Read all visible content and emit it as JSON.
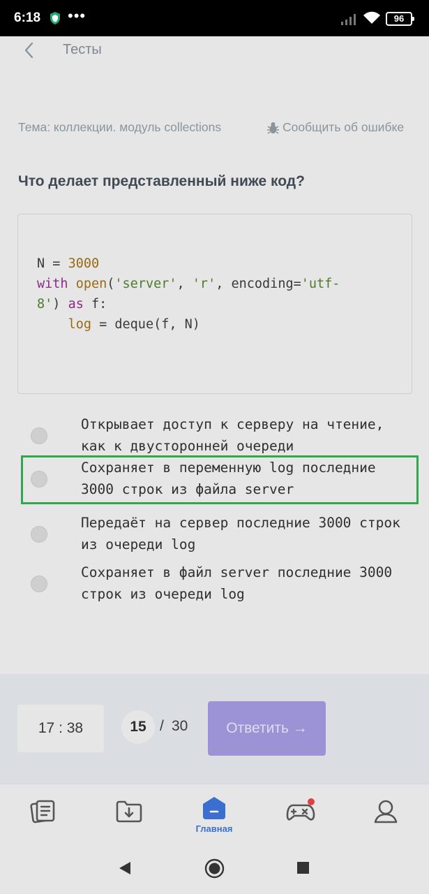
{
  "status_bar": {
    "time": "6:18",
    "dots": "•••",
    "battery": "96"
  },
  "header": {
    "title": "Тесты"
  },
  "topic": "Тема: коллекции. модуль collections",
  "report_label": "Сообщить об ошибке",
  "question": "Что делает представленный ниже код?",
  "code": {
    "line1_a": "N = ",
    "line1_num": "3000",
    "line2_kw": "with",
    "line2_fn": "open",
    "line2_p1": "(",
    "line2_s1": "'server'",
    "line2_p2": ", ",
    "line2_s2": "'r'",
    "line2_p3": ", encoding=",
    "line2_s3": "'utf-",
    "line3_s": "8'",
    "line3_p": ") ",
    "line3_kw": "as",
    "line3_rest": " f:",
    "line4_indent": "    ",
    "line4_fn": "log",
    "line4_rest": " = deque(f, N)"
  },
  "options": [
    {
      "text": "Открывает доступ к серверу на чтение, как к двусторонней очереди",
      "selected": false
    },
    {
      "text": "Сохраняет в переменную log последние 3000 строк из файла server",
      "selected": true
    },
    {
      "text": "Передаёт на сервер последние 3000 строк из очереди log",
      "selected": false
    },
    {
      "text": "Сохраняет в файл  server последние 3000 строк из очереди log",
      "selected": false
    }
  ],
  "bottom": {
    "timer": "17 : 38",
    "page_current": "15",
    "page_sep": "/",
    "page_total": "30",
    "answer_label": "Ответить →"
  },
  "nav": {
    "home_label": "Главная",
    "accent": "#3b6fcf",
    "badge_color": "#e04040"
  },
  "colors": {
    "selected_border": "#2ea84a",
    "answer_button": "#9b93d6"
  }
}
